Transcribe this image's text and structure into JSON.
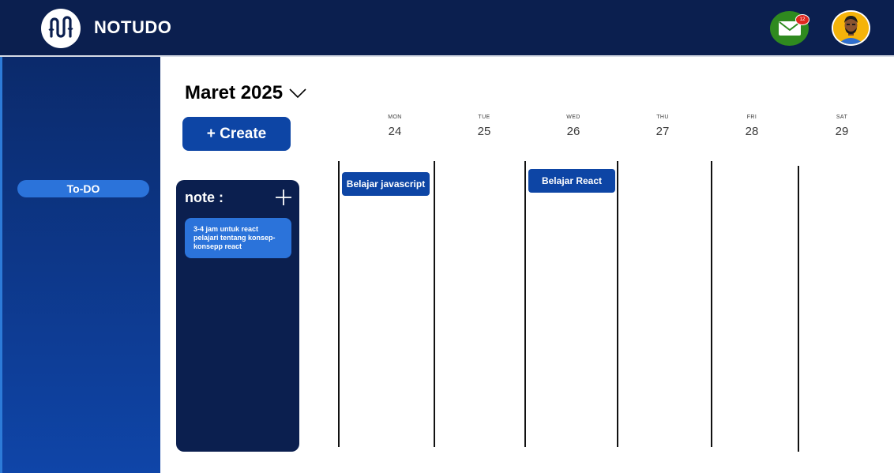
{
  "header": {
    "app_name": "NOTUDO",
    "mail_badge_count": "12",
    "icons": {
      "logo": "notudo-logo-icon",
      "mail": "mail-icon",
      "avatar": "user-avatar"
    }
  },
  "sidebar": {
    "items": [
      {
        "label": "To-DO"
      }
    ]
  },
  "calendar": {
    "month_label": "Maret 2025",
    "create_label": "+ Create",
    "days": [
      {
        "name": "MON",
        "num": "24"
      },
      {
        "name": "TUE",
        "num": "25"
      },
      {
        "name": "WED",
        "num": "26"
      },
      {
        "name": "THU",
        "num": "27"
      },
      {
        "name": "FRI",
        "num": "28"
      },
      {
        "name": "SAT",
        "num": "29"
      }
    ],
    "events": [
      {
        "title": "Belajar javascript"
      },
      {
        "title": "Belajar React"
      }
    ]
  },
  "notes": {
    "title": "note :",
    "items": [
      {
        "text": "3-4 jam untuk react pelajari tentang konsep-konsepp react"
      }
    ]
  },
  "colors": {
    "header_bg": "#0b1f4f",
    "accent": "#0d45a5",
    "light_accent": "#2b73da",
    "mail_green": "#2f8a1f",
    "badge_red": "#e0271f"
  }
}
